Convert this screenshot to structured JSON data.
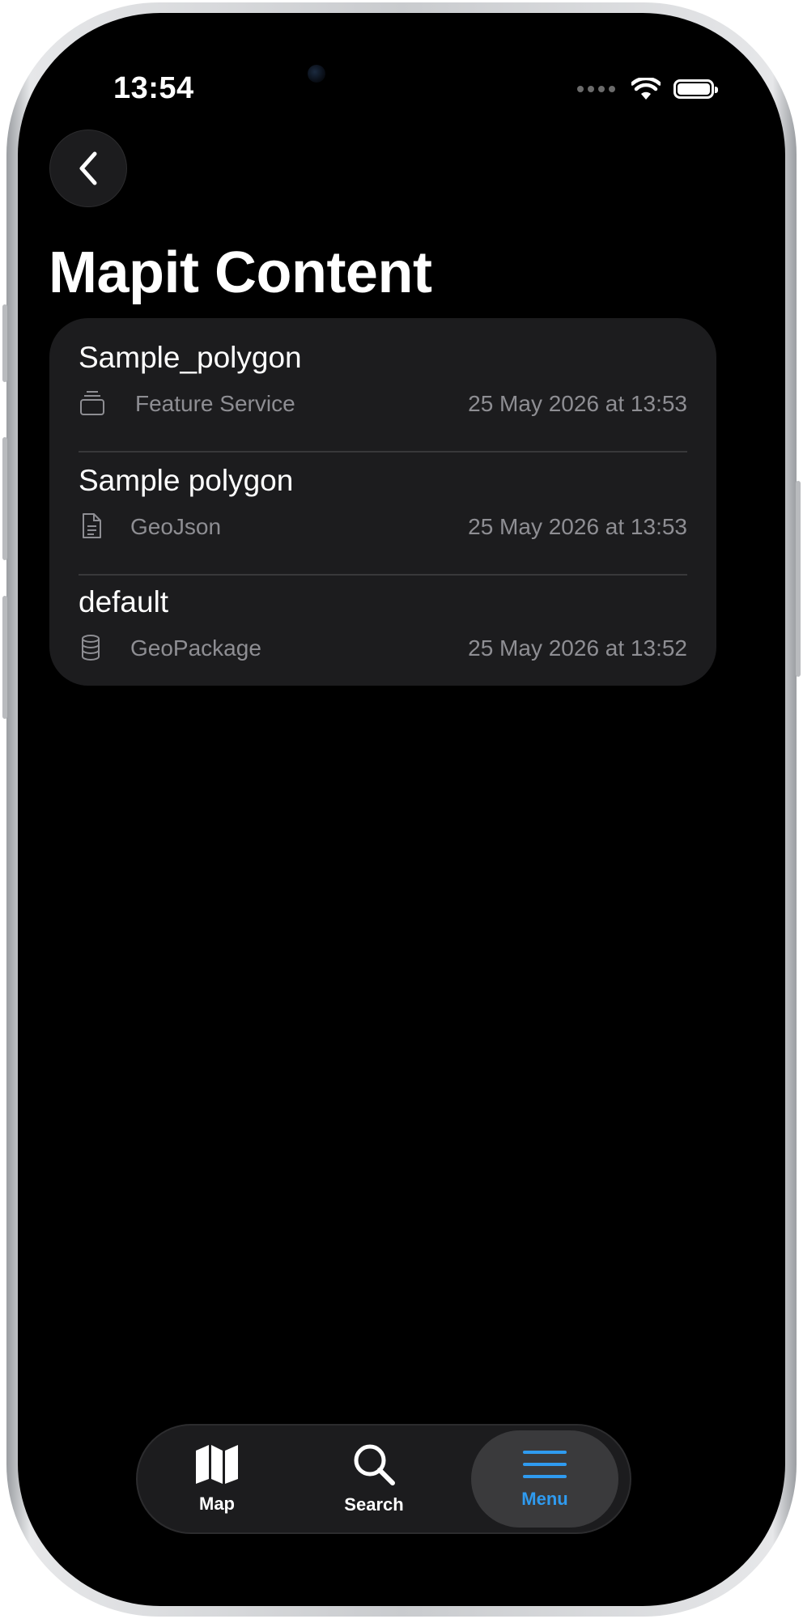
{
  "status_bar": {
    "time": "13:54"
  },
  "header": {
    "back_icon": "chevron-left-icon",
    "title": "Mapit Content"
  },
  "content_list": {
    "items": [
      {
        "name": "Sample_polygon",
        "type": "Feature Service",
        "date": "25 May 2026 at 13:53",
        "icon": "stack-icon"
      },
      {
        "name": "Sample polygon",
        "type": "GeoJson",
        "date": "25 May 2026 at 13:53",
        "icon": "document-icon"
      },
      {
        "name": "default",
        "type": "GeoPackage",
        "date": "25 May 2026 at 13:52",
        "icon": "database-icon"
      }
    ]
  },
  "tab_bar": {
    "tabs": [
      {
        "label": "Map",
        "icon": "map-icon",
        "active": false
      },
      {
        "label": "Search",
        "icon": "search-icon",
        "active": false
      },
      {
        "label": "Menu",
        "icon": "menu-icon",
        "active": true
      }
    ]
  },
  "colors": {
    "background": "#000000",
    "card": "#1c1c1e",
    "accent": "#2f9bf0",
    "secondary_text": "#8e8e93"
  }
}
